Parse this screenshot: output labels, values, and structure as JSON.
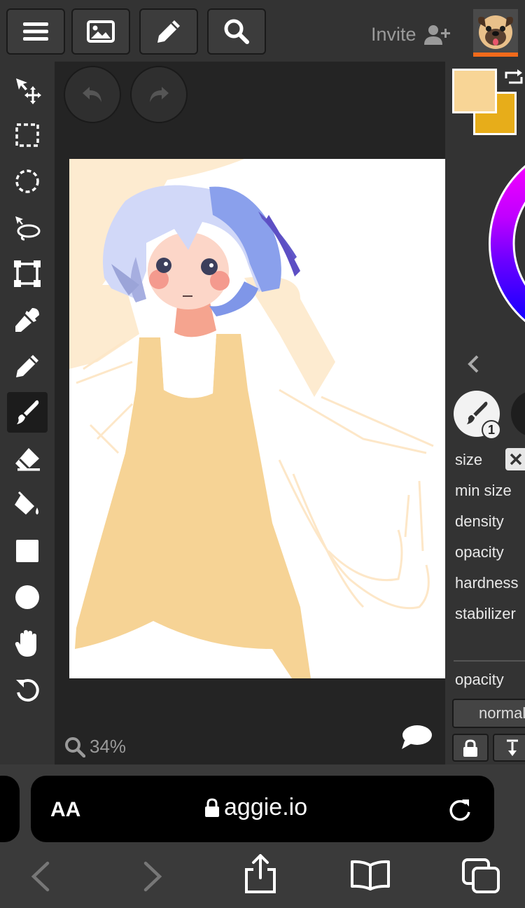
{
  "topbar": {
    "buttons": [
      "menu-icon",
      "image-icon",
      "pencil-icon",
      "search-icon"
    ],
    "invite_label": "Invite",
    "invite_icon": "add-user-icon",
    "avatar_icon": "pug-avatar-icon"
  },
  "tools": [
    {
      "name": "move-tool",
      "icon": "move-arrow-icon"
    },
    {
      "name": "rect-select-tool",
      "icon": "dashed-square-icon"
    },
    {
      "name": "ellipse-select-tool",
      "icon": "dashed-circle-icon"
    },
    {
      "name": "lasso-tool",
      "icon": "lasso-icon"
    },
    {
      "name": "transform-tool",
      "icon": "transform-icon"
    },
    {
      "name": "eyedropper-tool",
      "icon": "eyedropper-icon"
    },
    {
      "name": "pencil-tool",
      "icon": "pencil-icon"
    },
    {
      "name": "brush-tool",
      "icon": "brush-icon",
      "active": true
    },
    {
      "name": "eraser-tool",
      "icon": "eraser-icon"
    },
    {
      "name": "fill-tool",
      "icon": "paint-bucket-icon"
    },
    {
      "name": "rectangle-tool",
      "icon": "square-icon"
    },
    {
      "name": "ellipse-tool",
      "icon": "circle-icon"
    },
    {
      "name": "hand-tool",
      "icon": "hand-icon"
    },
    {
      "name": "rotate-tool",
      "icon": "rotate-icon"
    }
  ],
  "canvas": {
    "zoom": "34%",
    "undo_icon": "undo-icon",
    "redo_icon": "redo-icon",
    "chat_icon": "chat-bubble-icon"
  },
  "colors": {
    "primary": "#f8d596",
    "secondary": "#e7ad1a",
    "accent": "#f26a1b",
    "background": "#333333"
  },
  "brush_panel": {
    "brush_number": "1",
    "size_label": "size",
    "min_size_label": "min size",
    "density_label": "density",
    "opacity_label": "opacity",
    "hardness_label": "hardness",
    "stabilizer_label": "stabilizer",
    "layer_opacity_label": "opacity",
    "blend_mode": "normal"
  },
  "browser": {
    "text_size_label": "AA",
    "url": "aggie.io",
    "reload_icon": "reload-icon",
    "nav": [
      "back-icon",
      "forward-icon",
      "share-icon",
      "bookmarks-icon",
      "tabs-icon"
    ]
  }
}
